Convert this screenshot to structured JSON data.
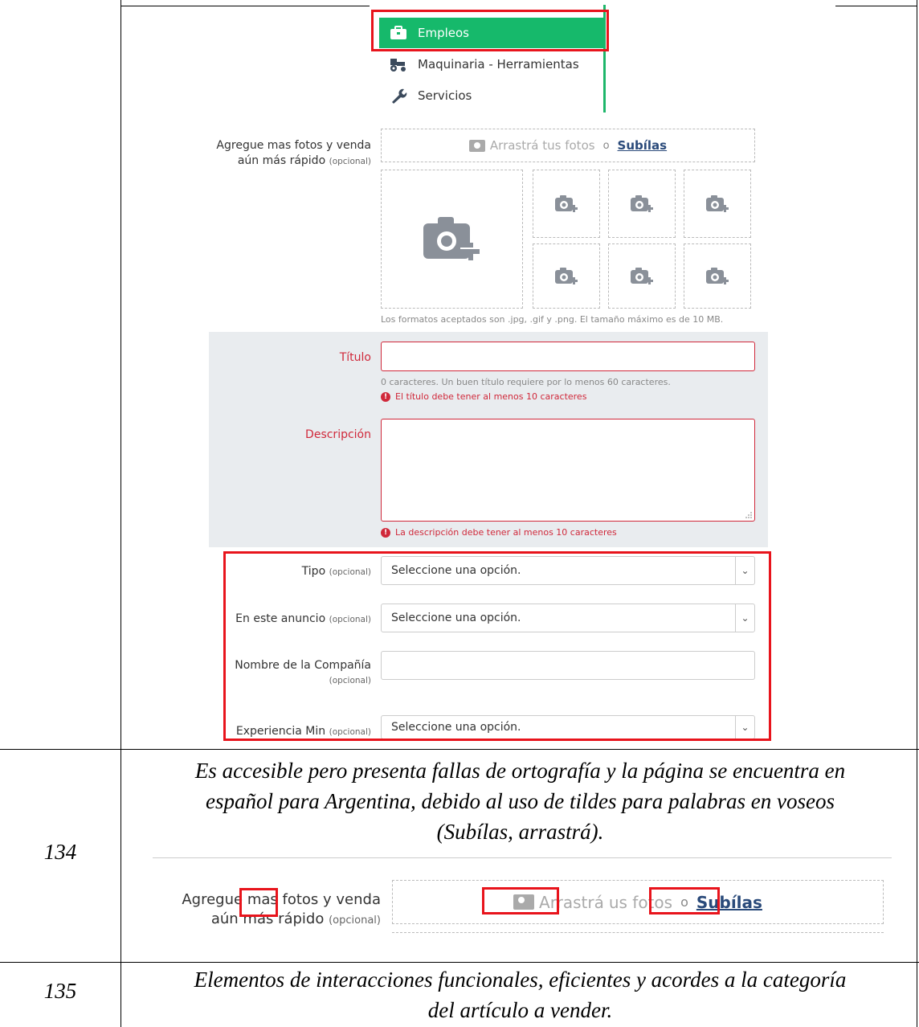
{
  "menu": {
    "items": [
      {
        "label": "Empleos",
        "icon": "briefcase-icon",
        "active": true
      },
      {
        "label": "Maquinaria - Herramientas",
        "icon": "tractor-icon",
        "active": false
      },
      {
        "label": "Servicios",
        "icon": "wrench-icon",
        "active": false
      }
    ]
  },
  "photos": {
    "label": "Agregue mas fotos y venda",
    "label2": "aún más rápido",
    "optional": "(opcional)",
    "drop_text": "Arrastrá tus fotos",
    "drop_or": "o",
    "drop_link": "Subílas",
    "formats_hint": "Los formatos aceptados son .jpg, .gif y .png. El tamaño máximo es de 10 MB."
  },
  "title_field": {
    "label": "Título",
    "hint": "0 caracteres. Un buen título requiere por lo menos 60 caracteres.",
    "error": "El título debe tener al menos 10 caracteres"
  },
  "description_field": {
    "label": "Descripción",
    "error": "La descripción debe tener al menos 10 caracteres"
  },
  "type_field": {
    "label": "Tipo",
    "optional": "(opcional)",
    "value": "Seleccione una opción."
  },
  "ad_field": {
    "label": "En este anuncio",
    "optional": "(opcional)",
    "value": "Seleccione una opción."
  },
  "company_field": {
    "label": "Nombre de la Compañía",
    "optional": "(opcional)"
  },
  "experience_field": {
    "label": "Experiencia Min",
    "optional": "(opcional)",
    "value": "Seleccione una opción."
  },
  "rows": [
    {
      "number": "134",
      "comment_lines": [
        "Es accesible pero presenta fallas de ortografía y la página se encuentra en",
        "español para Argentina, debido al uso de tildes para palabras en voseos",
        "(Subílas, arrastrá)."
      ]
    },
    {
      "number": "135",
      "comment_lines": [
        "Elementos de interacciones funcionales, eficientes y acordes a la categoría",
        "del artículo a vender."
      ]
    }
  ],
  "zoom": {
    "label_a": "Agregue",
    "label_b": "mas",
    "label_c": "fotos y venda",
    "label2": "aún más rápido",
    "optional": "(opcional)",
    "drop_text_a": "Arrastrá",
    "drop_text_b": "us fotos",
    "drop_or": "o",
    "drop_link": "Subílas"
  },
  "colors": {
    "accent_green": "#16b96b",
    "highlight_red": "#e8141c",
    "error_red": "#d0283a"
  }
}
